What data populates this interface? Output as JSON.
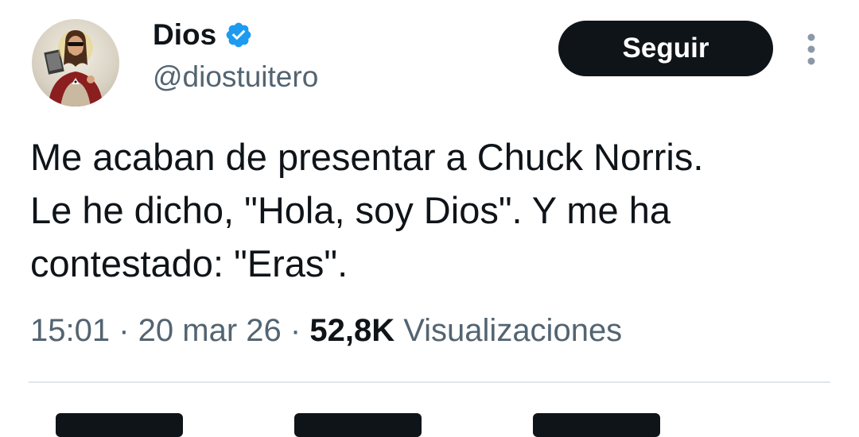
{
  "tweet": {
    "author": {
      "display_name": "Dios",
      "handle": "@diostuitero",
      "verified": true,
      "avatar_icon": "jesus-portrait-avatar"
    },
    "follow_button_label": "Seguir",
    "more_icon": "more-vertical-icon",
    "text_lines": [
      "Me acaban de presentar a Chuck Norris.",
      "Le he dicho, \"Hola, soy Dios\". Y me ha",
      "contestado: \"Eras\"."
    ],
    "time": "15:01",
    "separator": "·",
    "date": "20 mar 26",
    "views_count": "52,8K",
    "views_label": "Visualizaciones"
  },
  "colors": {
    "text_primary": "#0f1419",
    "text_secondary": "#536471",
    "verified_blue": "#1d9bf0",
    "button_bg": "#0f1419",
    "button_text": "#ffffff",
    "divider": "#e1e6ea"
  }
}
